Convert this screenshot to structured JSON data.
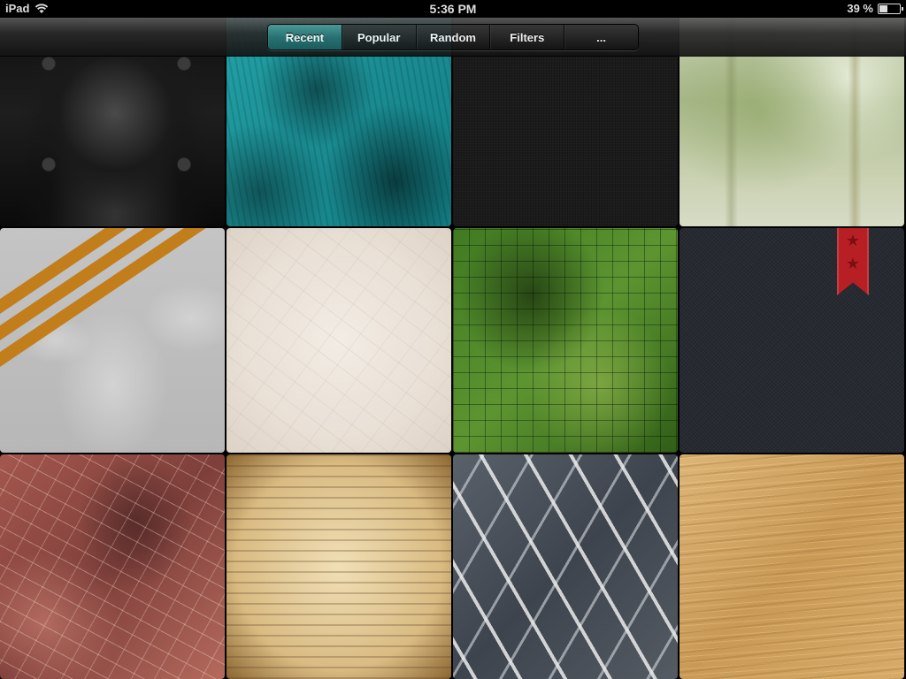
{
  "status_bar": {
    "device": "iPad",
    "time": "5:36 PM",
    "battery": "39 %",
    "battery_level": 0.39
  },
  "toolbar": {
    "segments": [
      {
        "label": "Recent",
        "active": true
      },
      {
        "label": "Popular",
        "active": false
      },
      {
        "label": "Random",
        "active": false
      },
      {
        "label": "Filters",
        "active": false
      },
      {
        "label": "...",
        "active": false
      }
    ],
    "accent_color": "#2a6f70"
  },
  "textures": [
    {
      "icon": "black-leather-texture"
    },
    {
      "icon": "teal-grunge-texture"
    },
    {
      "icon": "dark-fabric-texture"
    },
    {
      "icon": "green-aged-paper-texture"
    },
    {
      "icon": "concrete-orange-stripes-texture"
    },
    {
      "icon": "crumpled-paper-texture"
    },
    {
      "icon": "green-moss-tiles-texture"
    },
    {
      "icon": "dark-navy-fabric-texture",
      "favorite": true
    },
    {
      "icon": "red-marble-splatter-texture"
    },
    {
      "icon": "vintage-typed-paper-texture"
    },
    {
      "icon": "diamond-plate-metal-texture"
    },
    {
      "icon": "light-wood-grain-texture"
    }
  ],
  "favorite_ribbon_color": "#b81f24"
}
